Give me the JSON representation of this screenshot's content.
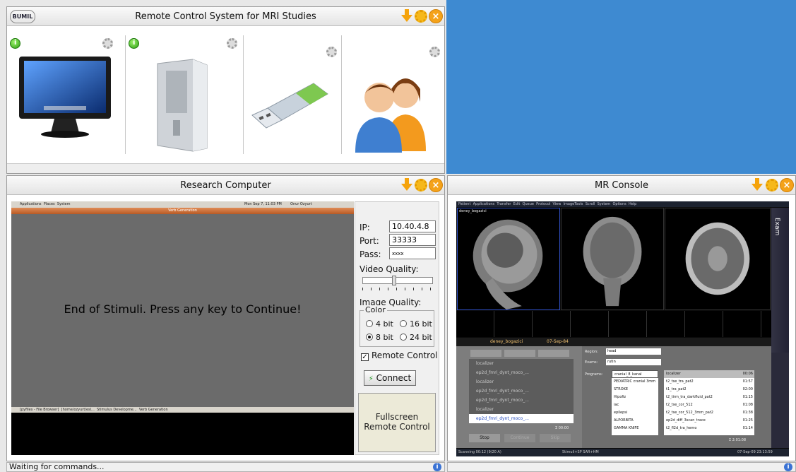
{
  "top_panel": {
    "logo": "BUMIL",
    "title": "Remote Control System for MRI Studies",
    "devices": [
      {
        "icon": "monitor-icon",
        "status": "on"
      },
      {
        "icon": "computer-tower-icon",
        "status": "on"
      },
      {
        "icon": "usb-drive-icon",
        "status": ""
      },
      {
        "icon": "users-icon",
        "status": ""
      }
    ]
  },
  "research_panel": {
    "title": "Research Computer",
    "remote_screen": {
      "topbar_menus": [
        "Applications",
        "Places",
        "System"
      ],
      "topbar_clock": "Mon Sep 7, 11:03 PM",
      "topbar_user": "Onur Ozyurt",
      "window_title": "Verb Generation",
      "message": "End of Stimuli. Press any key to Continue!",
      "taskbar_items": [
        "[pyfiles - File Browser]",
        "[home/ozyurt/esl...",
        "Stimulus Developme...",
        "Verb Generation"
      ]
    },
    "controls": {
      "ip_label": "IP:",
      "ip_value": "10.40.4.8",
      "port_label": "Port:",
      "port_value": "33333",
      "pass_label": "Pass:",
      "pass_value": "xxxx",
      "video_quality_label": "Video Quality:",
      "video_quality_level": 0.45,
      "image_quality_label": "Image Quality:",
      "color_group_label": "Color",
      "color_options": [
        "4 bit",
        "16 bit",
        "8 bit",
        "24 bit"
      ],
      "color_selected": "8 bit",
      "remote_control_label": "Remote Control",
      "remote_control_checked": true,
      "connect_label": "Connect",
      "fullscreen_label_line1": "Fullscreen",
      "fullscreen_label_line2": "Remote Control"
    }
  },
  "mr_panel": {
    "title": "MR Console",
    "menus": [
      "Patient",
      "Applications",
      "Transfer",
      "Edit",
      "Queue",
      "Protocol",
      "View",
      "ImageTools",
      "Scroll",
      "System",
      "Options",
      "Help"
    ],
    "patient_name": "deney_bogazici",
    "patient_date": "07-Sep-84",
    "side_tab": "Exam",
    "exam_list": [
      "localizer",
      "ep2d_fmri_dynt_moco_...",
      "localizer",
      "ep2d_fmri_dynt_moco_...",
      "ep2d_fmri_dynt_moco_...",
      "localizer",
      "ep2d_fmri_dynt_moco_..."
    ],
    "region_label": "Region:",
    "region_value": "head",
    "exams_label": "Exams:",
    "exams_value": "rutin",
    "programs_label": "Programs:",
    "programs": [
      "cranial_8_kanal",
      "PEDIATRIC cranial 3mm",
      "STROKE",
      "Hipofiz",
      "iac",
      "epilepsi",
      "ALPORBITA",
      "GAMMA KNIFE"
    ],
    "protocols": [
      {
        "name": "localizer",
        "time": "00:06"
      },
      {
        "name": "t2_tse_tra_pat2",
        "time": "01:57"
      },
      {
        "name": "t1_tra_pat2",
        "time": "02:00"
      },
      {
        "name": "t2_tirm_tra_darkfluid_pat2",
        "time": "01:15"
      },
      {
        "name": "t2_tse_cor_512",
        "time": "01:08"
      },
      {
        "name": "t2_tse_cor_512_3mm_pat2",
        "time": "01:38"
      },
      {
        "name": "ep2d_diff_3scan_trace",
        "time": "01:25"
      },
      {
        "name": "t2_fl2d_tra_hemo",
        "time": "01:14"
      }
    ],
    "total_left": "Σ 00:00",
    "total_right": "Σ 2:01:08",
    "buttons": [
      "Stop",
      "Continue",
      "Skip"
    ],
    "status_left": "Scanning 00:12 (9/20 A)",
    "status_mid": "Stimuli+SP SAR+HM",
    "status_right": "07-Sep-09 23:13:59"
  },
  "status_bar": {
    "left_text": "Waiting for commands...",
    "right_text": ""
  }
}
